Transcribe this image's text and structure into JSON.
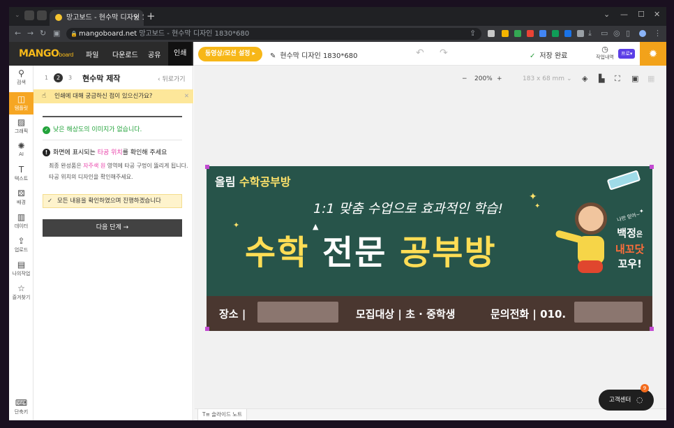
{
  "browser": {
    "tab_title": "망고보드 - 현수막 디자인 1",
    "url_domain": "mangoboard.net",
    "url_rest": " 망고보드 - 현수막 디자인 1830*680"
  },
  "app": {
    "logo_main": "MANGO",
    "logo_sub": "board",
    "menu": [
      "파일",
      "다운로드",
      "공유",
      "인쇄"
    ],
    "pill_button": "동영상/모션 설정",
    "doc_title": "현수막 디자인 1830*680",
    "save_status": "저장 완료",
    "history_label": "작업내역",
    "pro_label": "프로"
  },
  "rail": [
    "검색",
    "템플릿",
    "그래픽",
    "AI",
    "텍스트",
    "배경",
    "데이터",
    "업로드",
    "나의작업",
    "즐겨찾기",
    "단축키"
  ],
  "panel": {
    "steps": [
      "1",
      "2",
      "3"
    ],
    "title": "현수막 제작",
    "back": "뒤로가기",
    "notice": "인쇄에 대해 궁금하신 점이 있으신가요?",
    "ok_text": "낮은 해상도의 이미지가 없습니다.",
    "warn_pre": "화면에 표시되는 ",
    "warn_hl": "타공 위치",
    "warn_post": "를 확인해 주세요",
    "desc_pre": "최종 완성품은 ",
    "desc_hl": "자주색 원",
    "desc_post": " 영역에 타공 구멍이 뚫리게 됩니다. 타공 위치의 디자인을 확인해주세요.",
    "check_text": "모든 내용을 확인하였으며 진행하겠습니다",
    "next_button": "다음 단계 →"
  },
  "canvas_toolbar": {
    "zoom": "200%",
    "size": "183 x 68 mm"
  },
  "banner": {
    "small_1": "올림 ",
    "small_2": "수학공부방",
    "slogan": "1:1 맞춤 수업으로 효과적인 학습!",
    "main_1": "수학 ",
    "main_2": "전문 ",
    "main_3": "공부방",
    "place": "장소 |",
    "target": "모집대상 | 초 · 중학생",
    "phone": "문의전화 | 010.",
    "tiny": "나만 믿어~",
    "side_1": "백정",
    "side_1b": "은",
    "side_2": "내꼬닷",
    "side_3": "꼬우!"
  },
  "bottom": {
    "slide_note": "슬라이드 노트",
    "support": "고객센터",
    "badge": "9"
  }
}
